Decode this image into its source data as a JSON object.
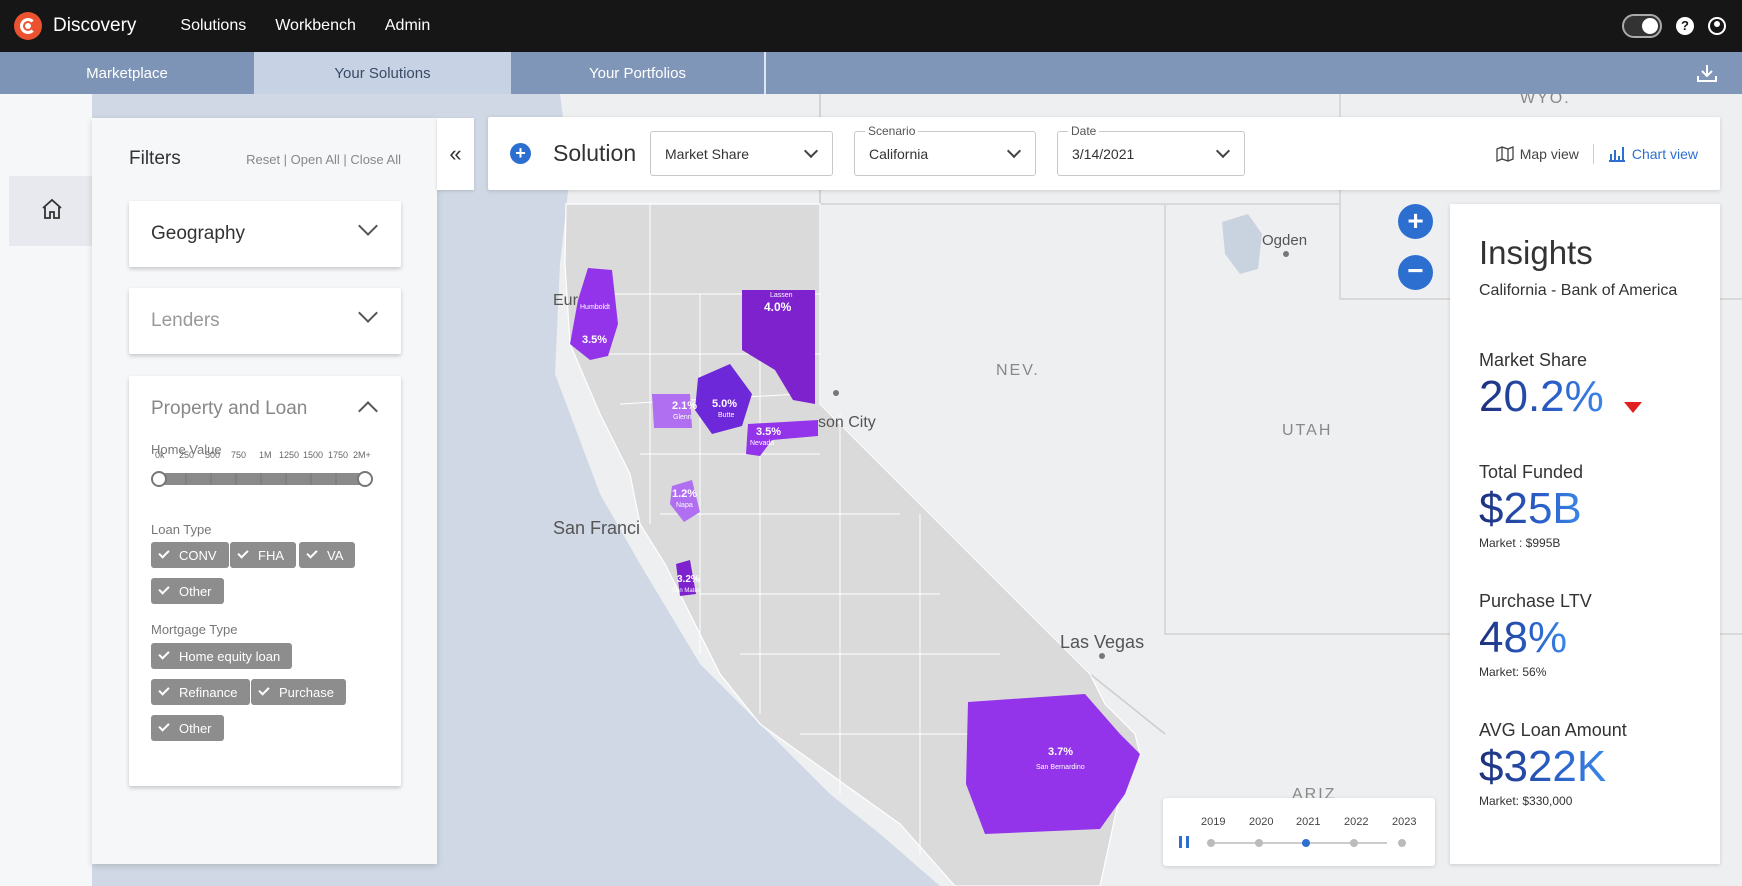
{
  "app": {
    "title": "Discovery"
  },
  "topnav": [
    "Solutions",
    "Workbench",
    "Admin"
  ],
  "tabs": [
    "Marketplace",
    "Your Solutions",
    "Your Portfolios"
  ],
  "filters": {
    "title": "Filters",
    "links": "Reset | Open All | Close All",
    "geography": "Geography",
    "lenders": "Lenders",
    "property_loan": "Property and Loan",
    "home_value_label": "Home Value",
    "home_value_ticks": [
      "0k",
      "250",
      "500",
      "750",
      "1M",
      "1250",
      "1500",
      "1750",
      "2M+"
    ],
    "loan_type_label": "Loan Type",
    "loan_types": [
      "CONV",
      "FHA",
      "VA",
      "Other"
    ],
    "mortgage_type_label": "Mortgage Type",
    "mortgage_types": [
      "Home equity loan",
      "Refinance",
      "Purchase",
      "Other"
    ]
  },
  "toolbar": {
    "solution": "Solution",
    "metric": "Market Share",
    "scenario_label": "Scenario",
    "scenario": "California",
    "date_label": "Date",
    "date": "3/14/2021",
    "map_view": "Map view",
    "chart_view": "Chart view"
  },
  "map": {
    "places": [
      "Ogden",
      "Las Vegas",
      "San Franci",
      "son City",
      "Eur"
    ],
    "states": [
      "NEV.",
      "UTAH",
      "ARIZ",
      "WYO."
    ],
    "highlights": [
      {
        "county": "Humboldt",
        "share": "3.5%"
      },
      {
        "county": "Lassen",
        "share": "4.0%"
      },
      {
        "county": "Glenn",
        "share": "2.1%"
      },
      {
        "county": "Butte",
        "share": "5.0%"
      },
      {
        "county": "Nevada",
        "share": "3.5%"
      },
      {
        "county": "Napa",
        "share": "1.2%"
      },
      {
        "county": "San Mateo",
        "share": "3.2%"
      },
      {
        "county": "San Bernardino",
        "share": "3.7%"
      }
    ]
  },
  "insights": {
    "title": "Insights",
    "subtitle": "California - Bank of America",
    "market_share_label": "Market Share",
    "market_share": "20.2%",
    "total_funded_label": "Total Funded",
    "total_funded": "$25B",
    "total_funded_market": "Market : $995B",
    "ltv_label": "Purchase LTV",
    "ltv": "48%",
    "ltv_market": "Market: 56%",
    "avg_loan_label": "AVG Loan Amount",
    "avg_loan": "$322K",
    "avg_loan_market": "Market: $330,000"
  },
  "timeline": {
    "years": [
      "2019",
      "2020",
      "2021",
      "2022",
      "2023"
    ],
    "selected": "2021"
  },
  "colors": {
    "accent": "#2d6fd1",
    "highlight": "#9333ea",
    "dark_highlight": "#6d28d9",
    "brand": "#ea5230"
  }
}
